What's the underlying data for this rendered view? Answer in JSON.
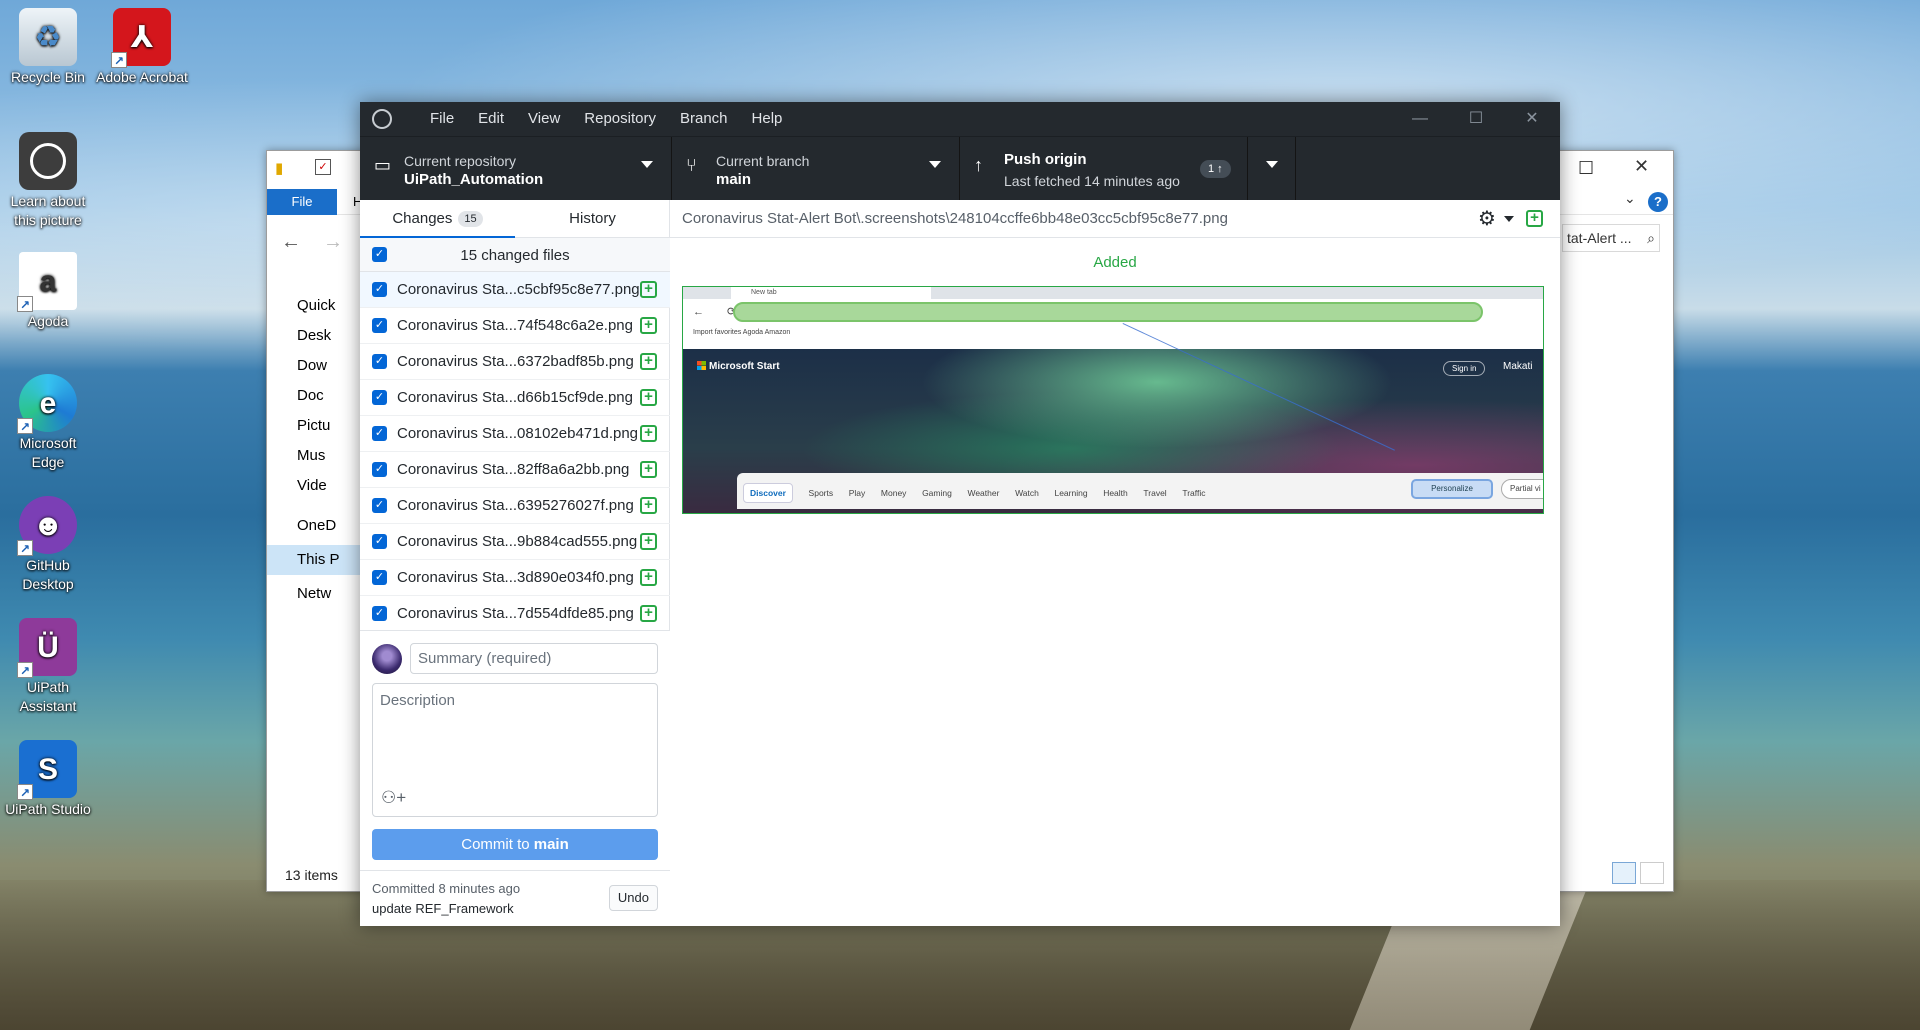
{
  "desktop": {
    "icons": [
      {
        "label": "Recycle Bin"
      },
      {
        "label": "Adobe Acrobat"
      },
      {
        "label": "Learn about this picture"
      },
      {
        "label": "Agoda"
      },
      {
        "label": "Microsoft Edge"
      },
      {
        "label": "GitHub Desktop"
      },
      {
        "label": "UiPath Assistant"
      },
      {
        "label": "UiPath Studio"
      }
    ]
  },
  "explorer": {
    "file_tab": "File",
    "ribbon_h": "H",
    "search_placeholder": "tat-Alert ...",
    "tree": [
      "Quick",
      "Desk",
      "Dow",
      "Doc",
      "Pictu",
      "Mus",
      "Vide",
      "OneD",
      "This P",
      "Netw"
    ],
    "status": "13 items"
  },
  "github": {
    "menu": [
      "File",
      "Edit",
      "View",
      "Repository",
      "Branch",
      "Help"
    ],
    "toolbar": {
      "repo_label": "Current repository",
      "repo_name": "UiPath_Automation",
      "branch_label": "Current branch",
      "branch_name": "main",
      "push_title": "Push origin",
      "push_sub": "Last fetched 14 minutes ago",
      "push_badge": "1 ↑"
    },
    "tabs": {
      "changes": "Changes",
      "changes_count": "15",
      "history": "History"
    },
    "changed_files_label": "15 changed files",
    "files": [
      "Coronavirus Sta...c5cbf95c8e77.png",
      "Coronavirus Sta...74f548c6a2e.png",
      "Coronavirus Sta...6372badf85b.png",
      "Coronavirus Sta...d66b15cf9de.png",
      "Coronavirus Sta...08102eb471d.png",
      "Coronavirus Sta...82ff8a6a2bb.png",
      "Coronavirus Sta...6395276027f.png",
      "Coronavirus Sta...9b884cad555.png",
      "Coronavirus Sta...3d890e034f0.png",
      "Coronavirus Sta...7d554dfde85.png"
    ],
    "summary_placeholder": "Summary (required)",
    "description_placeholder": "Description",
    "commit_prefix": "Commit to ",
    "commit_branch": "main",
    "last_commit": {
      "time": "Committed 8 minutes ago",
      "message": "update REF_Framework",
      "undo": "Undo"
    },
    "diff": {
      "path": "Coronavirus Stat-Alert Bot\\.screenshots\\248104ccffe6bb48e03cc5cbf95c8e77.png",
      "status": "Added"
    },
    "preview": {
      "tab_title": "New tab",
      "bookmarks": "Import favorites    Agoda    Amazon",
      "brand": "Microsoft Start",
      "signin": "Sign in",
      "location": "Makati",
      "nav": [
        "Discover",
        "Sports",
        "Play",
        "Money",
        "Gaming",
        "Weather",
        "Watch",
        "Learning",
        "Health",
        "Travel",
        "Traffic"
      ],
      "personalize": "Personalize",
      "partial": "Partial vi"
    }
  }
}
